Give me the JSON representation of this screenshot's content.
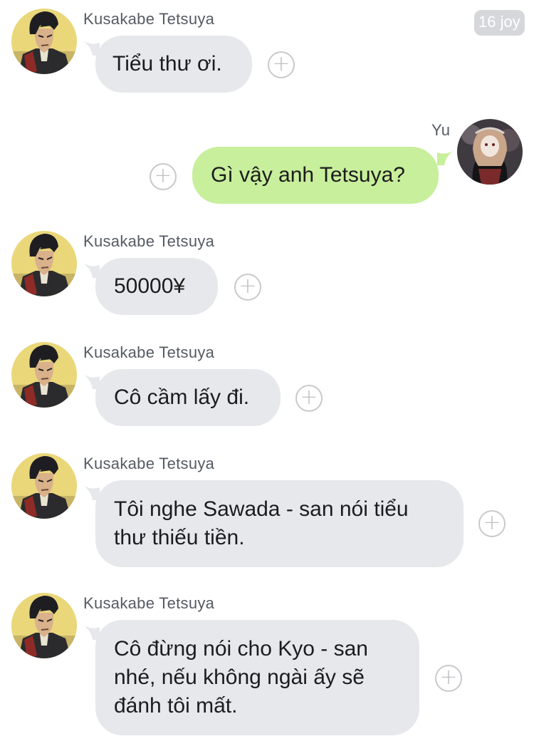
{
  "timestamp": "16 joy",
  "icons": {
    "add": "+"
  },
  "colors": {
    "incoming_bubble": "#e6e8ec",
    "outgoing_bubble": "#c8ef9c",
    "name_text": "#555b63"
  },
  "messages": [
    {
      "sender": "Kusakabe Tetsuya",
      "direction": "incoming",
      "text": "Tiểu thư ơi."
    },
    {
      "sender": "Yu",
      "direction": "outgoing",
      "text": "Gì vậy anh Tetsuya?"
    },
    {
      "sender": "Kusakabe Tetsuya",
      "direction": "incoming",
      "text": "50000¥"
    },
    {
      "sender": "Kusakabe Tetsuya",
      "direction": "incoming",
      "text": "Cô cầm lấy đi."
    },
    {
      "sender": "Kusakabe Tetsuya",
      "direction": "incoming",
      "text": "Tôi nghe Sawada - san nói tiểu thư thiếu tiền."
    },
    {
      "sender": "Kusakabe Tetsuya",
      "direction": "incoming",
      "text": "Cô đừng nói cho Kyo - san nhé, nếu không ngài ấy sẽ đánh tôi mất."
    }
  ]
}
